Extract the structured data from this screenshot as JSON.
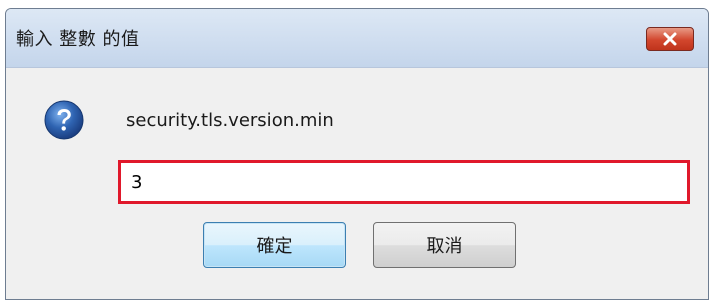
{
  "dialog": {
    "title": "輸入 整數 的值",
    "message": "security.tls.version.min",
    "input_value": "3",
    "ok_label": "確定",
    "cancel_label": "取消"
  },
  "icons": {
    "close": "close-icon",
    "question": "question-icon"
  },
  "colors": {
    "input_border": "#e0182b",
    "close_button": "#d2462d",
    "question_icon": "#2f64b2"
  }
}
